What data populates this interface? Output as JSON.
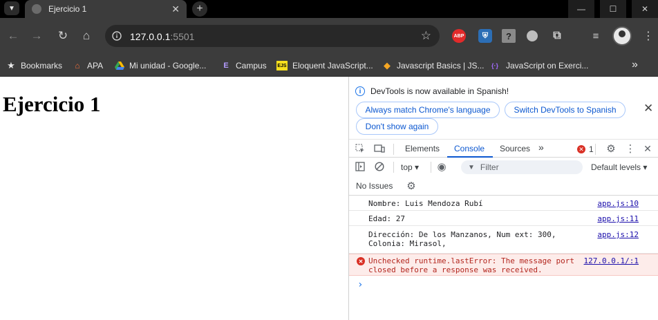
{
  "browser": {
    "tab_title": "Ejercicio 1",
    "tab_close": "✕",
    "new_tab": "+",
    "window": {
      "minimize": "—",
      "maximize": "☐",
      "close": "✕"
    },
    "url_host": "127.0.0.1",
    "url_port": ":5501",
    "nav": {
      "back": "←",
      "forward": "→",
      "reload": "↻",
      "home": "⌂"
    },
    "extensions": {
      "abp": "ABP",
      "shield": "⛨",
      "help": "?"
    },
    "bookmarks": [
      {
        "label": "Bookmarks",
        "icon": "star-icon",
        "glyph": "★",
        "color": "#e8e8e8"
      },
      {
        "label": "APA",
        "icon": "apa-icon",
        "glyph": "▲",
        "color": "#f36f3a"
      },
      {
        "label": "Mi unidad - Google...",
        "icon": "google-drive-icon",
        "glyph": "▲",
        "color": "#34a853"
      },
      {
        "label": "Campus",
        "icon": "campus-icon",
        "glyph": "E",
        "color": "#b49cff"
      },
      {
        "label": "Eloquent JavaScript...",
        "icon": "ejs-icon",
        "glyph": "EJS",
        "color": "#f7df1e"
      },
      {
        "label": "Javascript Basics | JS...",
        "icon": "diamond-icon",
        "glyph": "◆",
        "color": "#f5a623"
      },
      {
        "label": "JavaScript on Exerci...",
        "icon": "exercism-icon",
        "glyph": "{·}",
        "color": "#a46bff"
      }
    ],
    "bookmarks_more": "»"
  },
  "page": {
    "heading": "Ejercicio 1"
  },
  "devtools": {
    "info_text": "DevTools is now available in Spanish!",
    "info_buttons": {
      "match": "Always match Chrome's language",
      "switch": "Switch DevTools to Spanish",
      "dont": "Don't show again"
    },
    "info_close": "✕",
    "tabs": [
      "Elements",
      "Console",
      "Sources"
    ],
    "active_tab": "Console",
    "more_tabs": "»",
    "error_count": "1",
    "console_toolbar": {
      "context": "top ▾",
      "filter_placeholder": "Filter",
      "levels": "Default levels ▾"
    },
    "issues": "No Issues",
    "logs": [
      {
        "type": "log",
        "message": "Nombre: Luis Mendoza Rubí",
        "source": "app.js:10"
      },
      {
        "type": "log",
        "message": "Edad: 27",
        "source": "app.js:11"
      },
      {
        "type": "log",
        "message": "Dirección: De los Manzanos, Num ext: 300,\nColonia: Mirasol,",
        "source": "app.js:12"
      },
      {
        "type": "error",
        "message": "Unchecked runtime.lastError: The message port\nclosed before a response was received.",
        "source": "127.0.0.1/:1"
      }
    ],
    "prompt": "›"
  },
  "colors": {
    "chrome_dark": "#3c3c3c",
    "accent": "#0b57d0",
    "error": "#d93025"
  }
}
